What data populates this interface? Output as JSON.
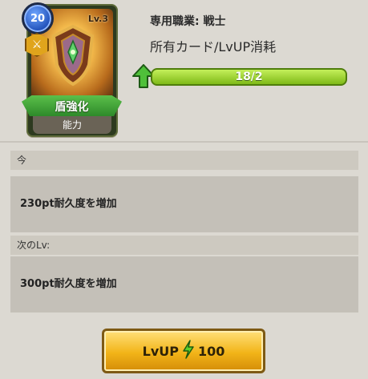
{
  "card": {
    "level_badge": "20",
    "lv_label": "Lv.3",
    "name": "盾強化",
    "category": "能力",
    "art_icon": "shield-icon",
    "class_icon": "warrior-class-icon"
  },
  "info": {
    "job": "専用職業: 戦士",
    "cost_label": "所有カード/LvUP消耗",
    "progress_text": "18/2",
    "progress_fraction": 1.0
  },
  "current": {
    "header": "今",
    "effect": "230pt耐久度を増加"
  },
  "next": {
    "header": "次のLv:",
    "effect": "300pt耐久度を増加"
  },
  "button": {
    "label": "LvUP",
    "cost": "100",
    "cost_icon": "lightning-bolt-icon"
  },
  "colors": {
    "accent_green": "#7fba18",
    "button_gold": "#f2b418",
    "badge_blue": "#1f4fb8"
  }
}
